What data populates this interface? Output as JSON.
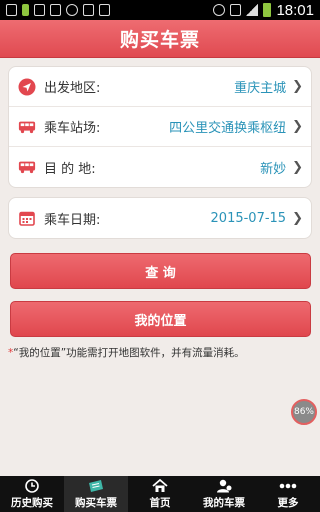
{
  "status_bar": {
    "time": "18:01"
  },
  "header": {
    "title": "购买车票"
  },
  "route_card": {
    "rows": [
      {
        "label": "出发地区:",
        "value": "重庆主城",
        "icon": "location-arrow-icon"
      },
      {
        "label": "乘车站场:",
        "value": "四公里交通换乘枢纽",
        "icon": "bus-icon"
      },
      {
        "label": "目 的 地:",
        "value": "新妙",
        "icon": "bus-icon"
      }
    ]
  },
  "date_card": {
    "label": "乘车日期:",
    "value": "2015-07-15",
    "icon": "calendar-icon"
  },
  "buttons": {
    "query": "查 询",
    "my_location": "我的位置"
  },
  "note": {
    "star": "*",
    "text": "“我的位置”功能需打开地图软件，并有流量消耗。"
  },
  "badge": {
    "text": "86%"
  },
  "tabs": [
    {
      "label": "历史购买",
      "icon": "clock-icon"
    },
    {
      "label": "购买车票",
      "icon": "ticket-icon"
    },
    {
      "label": "首页",
      "icon": "home-icon"
    },
    {
      "label": "我的车票",
      "icon": "user-icon"
    },
    {
      "label": "更多",
      "icon": "more-icon"
    }
  ],
  "colors": {
    "accent": "#e04a51",
    "link": "#2a93b8",
    "tabbar": "#111111"
  }
}
